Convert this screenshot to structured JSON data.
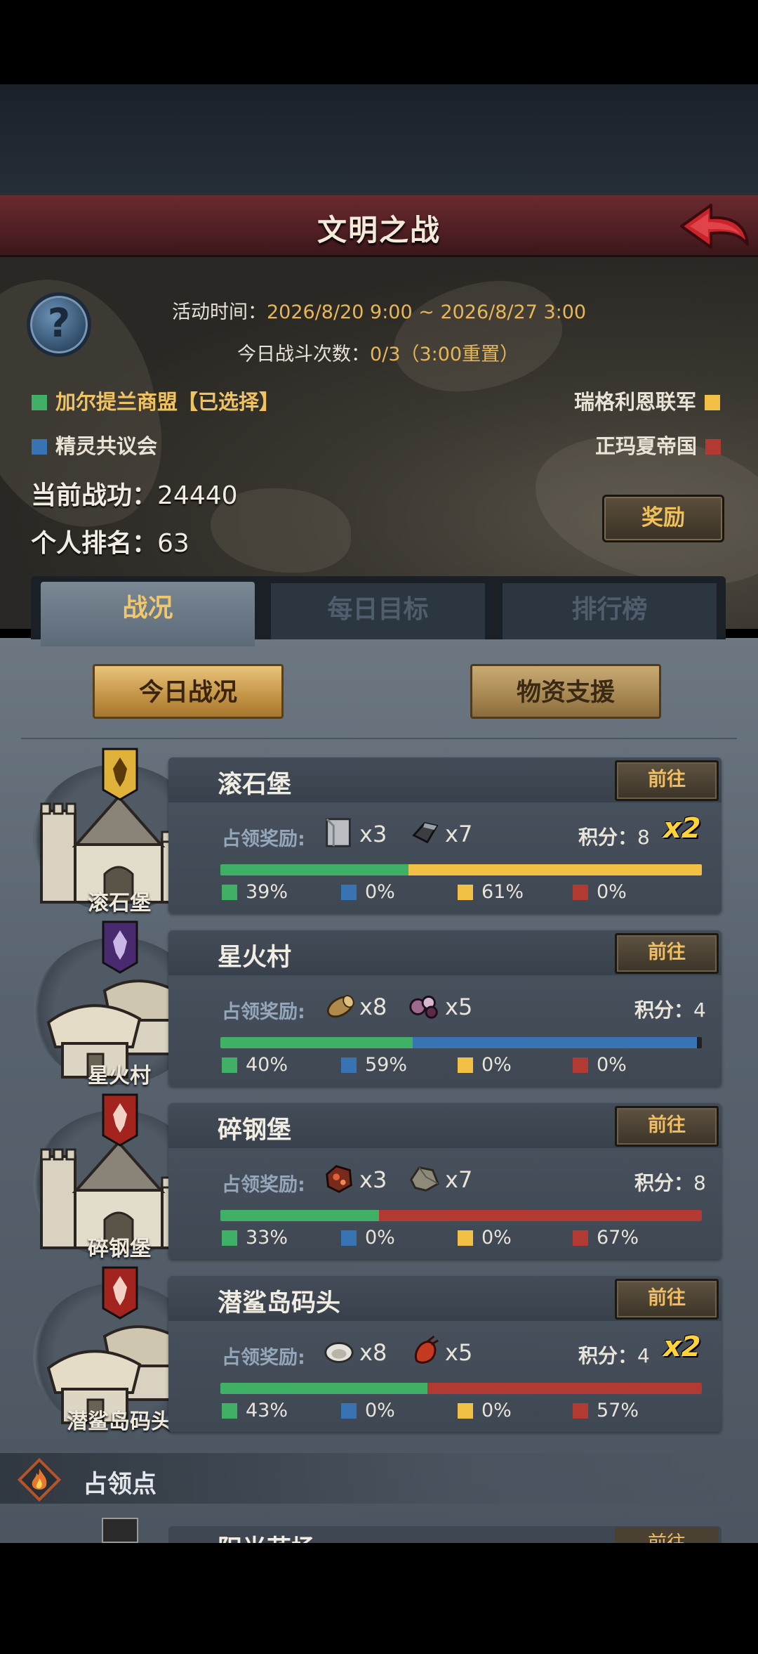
{
  "title": "文明之战",
  "event": {
    "time_label": "活动时间：",
    "time_value": "2026/8/20 9:00 ~ 2026/8/27 3:00",
    "count_label": "今日战斗次数：",
    "count_value": "0/3（3:00重置）"
  },
  "factions": {
    "green": {
      "name": "加尔提兰商盟【已选择】",
      "color": "#3fb065"
    },
    "blue": {
      "name": "精灵共议会",
      "color": "#3873b4"
    },
    "yellow": {
      "name": "瑞格利恩联军",
      "color": "#f3c046"
    },
    "red": {
      "name": "正玛夏帝国",
      "color": "#b23a33"
    }
  },
  "stats": {
    "merit_label": "当前战功：",
    "merit_value": "24440",
    "rank_label": "个人排名：",
    "rank_value": "63"
  },
  "reward_button": "奖励",
  "tabs": [
    "战况",
    "每日目标",
    "排行榜"
  ],
  "sub_buttons": {
    "today": "今日战况",
    "supply": "物资支援"
  },
  "card_common": {
    "reward_label": "占领奖励:",
    "go": "前往",
    "score_label": "积分："
  },
  "locations": [
    {
      "name": "滚石堡",
      "building": "castle",
      "banner": "gold",
      "rewards": [
        {
          "icon": "stone-block-icon",
          "count": "x3"
        },
        {
          "icon": "iron-ingot-icon",
          "count": "x7"
        }
      ],
      "score": "8",
      "bonus": "x2",
      "pct": {
        "green": 39,
        "blue": 0,
        "yellow": 61,
        "red": 0
      },
      "pct_text": [
        "39%",
        "0%",
        "61%",
        "0%"
      ]
    },
    {
      "name": "星火村",
      "building": "hut",
      "banner": "purple",
      "rewards": [
        {
          "icon": "wood-log-icon",
          "count": "x8"
        },
        {
          "icon": "berries-icon",
          "count": "x5"
        }
      ],
      "score": "4",
      "bonus": "",
      "pct": {
        "green": 40,
        "blue": 59,
        "yellow": 0,
        "red": 0
      },
      "pct_text": [
        "40%",
        "59%",
        "0%",
        "0%"
      ]
    },
    {
      "name": "碎钢堡",
      "building": "castle",
      "banner": "red",
      "rewards": [
        {
          "icon": "copper-ore-icon",
          "count": "x3"
        },
        {
          "icon": "stone-ore-icon",
          "count": "x7"
        }
      ],
      "score": "8",
      "bonus": "",
      "pct": {
        "green": 33,
        "blue": 0,
        "yellow": 0,
        "red": 67
      },
      "pct_text": [
        "33%",
        "0%",
        "0%",
        "67%"
      ]
    },
    {
      "name": "潜鲨岛码头",
      "building": "hut",
      "banner": "red",
      "rewards": [
        {
          "icon": "oyster-icon",
          "count": "x8"
        },
        {
          "icon": "lobster-icon",
          "count": "x5"
        }
      ],
      "score": "4",
      "bonus": "x2",
      "pct": {
        "green": 43,
        "blue": 0,
        "yellow": 0,
        "red": 57
      },
      "pct_text": [
        "43%",
        "0%",
        "0%",
        "57%"
      ]
    }
  ],
  "section": {
    "title": "占领点"
  },
  "peek": {
    "name": "阳光花场",
    "go": "前往"
  }
}
